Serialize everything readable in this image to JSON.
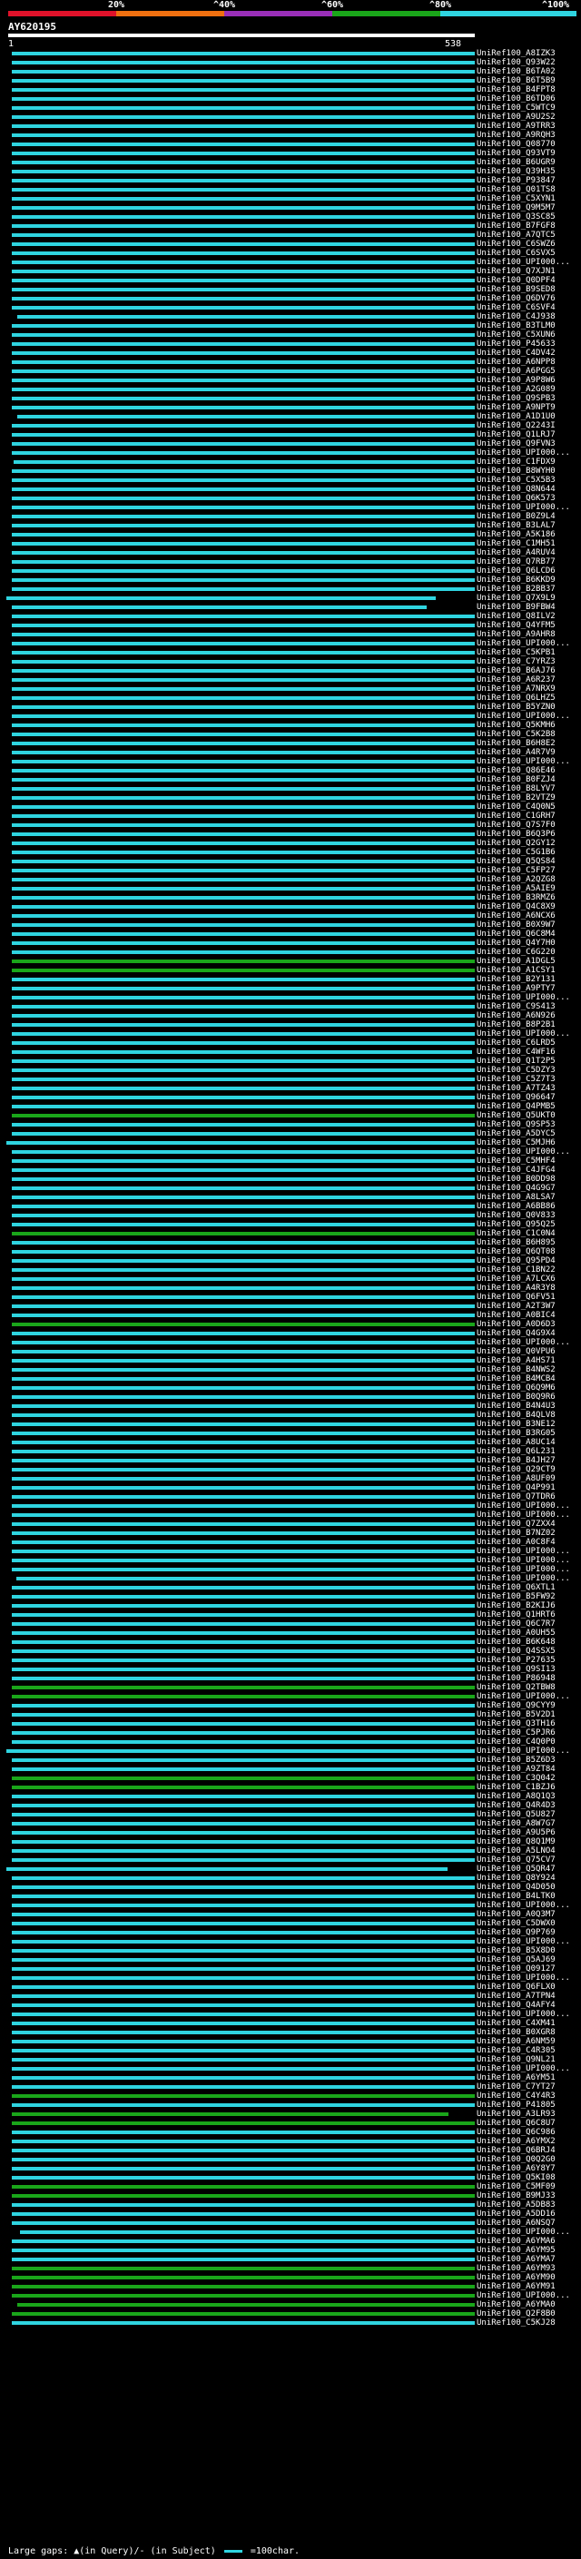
{
  "legend": {
    "labels": [
      "20%",
      "^40%",
      "^60%",
      "^80%",
      "^100%"
    ],
    "segments": [
      {
        "color": "#e0122a"
      },
      {
        "color": "#f07010"
      },
      {
        "color": "#9a2fb8"
      },
      {
        "color": "#1aa61a"
      },
      {
        "color": "#2fd4e0"
      }
    ]
  },
  "query": {
    "id": "AY620195",
    "start": "1",
    "end": "538"
  },
  "colors": {
    "cyan": "#2fd4e0",
    "green": "#1aa61a",
    "white": "#ffffff"
  },
  "hits": [
    {
      "acc": "UniRef100_A8IZK3"
    },
    {
      "acc": "UniRef100_Q93W22"
    },
    {
      "acc": "UniRef100_B6TA02"
    },
    {
      "acc": "UniRef100_B6T5B9"
    },
    {
      "acc": "UniRef100_B4FPT8"
    },
    {
      "acc": "UniRef100_B6TD06"
    },
    {
      "acc": "UniRef100_C5WTC9"
    },
    {
      "acc": "UniRef100_A9U2S2"
    },
    {
      "acc": "UniRef100_A9TRR3"
    },
    {
      "acc": "UniRef100_A9RQH3"
    },
    {
      "acc": "UniRef100_Q08770"
    },
    {
      "acc": "UniRef100_Q93VT9"
    },
    {
      "acc": "UniRef100_B6UGR9"
    },
    {
      "acc": "UniRef100_Q39H35"
    },
    {
      "acc": "UniRef100_P93847"
    },
    {
      "acc": "UniRef100_Q01TS8"
    },
    {
      "acc": "UniRef100_C5XYN1"
    },
    {
      "acc": "UniRef100_Q9M5M7"
    },
    {
      "acc": "UniRef100_Q3SC85"
    },
    {
      "acc": "UniRef100_B7FGF8"
    },
    {
      "acc": "UniRef100_A7QTC5"
    },
    {
      "acc": "UniRef100_C6SWZ6"
    },
    {
      "acc": "UniRef100_C6SVX5"
    },
    {
      "acc": "UniRef100_UPI000..."
    },
    {
      "acc": "UniRef100_Q7XJN1"
    },
    {
      "acc": "UniRef100_Q0DPF4"
    },
    {
      "acc": "UniRef100_B9SED8"
    },
    {
      "acc": "UniRef100_Q6DV76"
    },
    {
      "acc": "UniRef100_C6SVF4"
    },
    {
      "acc": "UniRef100_C4J938"
    },
    {
      "acc": "UniRef100_B3TLM0"
    },
    {
      "acc": "UniRef100_C5XUN6"
    },
    {
      "acc": "UniRef100_P45633"
    },
    {
      "acc": "UniRef100_C4DV42"
    },
    {
      "acc": "UniRef100_A6NPP8"
    },
    {
      "acc": "UniRef100_A6PGG5"
    },
    {
      "acc": "UniRef100_A9P8W6"
    },
    {
      "acc": "UniRef100_A2G089"
    },
    {
      "acc": "UniRef100_Q9SPB3"
    },
    {
      "acc": "UniRef100_A9NPT9"
    },
    {
      "acc": "UniRef100_A1D1U0"
    },
    {
      "acc": "UniRef100_Q2243I"
    },
    {
      "acc": "UniRef100_Q1LRJ7"
    },
    {
      "acc": "UniRef100_Q9FVN3"
    },
    {
      "acc": "UniRef100_UPI000..."
    },
    {
      "acc": "UniRef100_C1FDX9"
    },
    {
      "acc": "UniRef100_B8WYH0"
    },
    {
      "acc": "UniRef100_C5X5B3"
    },
    {
      "acc": "UniRef100_Q8N644"
    },
    {
      "acc": "UniRef100_Q6K573"
    },
    {
      "acc": "UniRef100_UPI000..."
    },
    {
      "acc": "UniRef100_B0Z9L4"
    },
    {
      "acc": "UniRef100_B3LAL7"
    },
    {
      "acc": "UniRef100_A5K186"
    },
    {
      "acc": "UniRef100_C1MH51"
    },
    {
      "acc": "UniRef100_A4RUV4"
    },
    {
      "acc": "UniRef100_Q7RB77"
    },
    {
      "acc": "UniRef100_Q6LCD6"
    },
    {
      "acc": "UniRef100_B6KKD9"
    },
    {
      "acc": "UniRef100_B2BB37"
    },
    {
      "acc": "UniRef100_Q7X9L9"
    },
    {
      "acc": "UniRef100_B9FBW4"
    },
    {
      "acc": "UniRef100_Q8ILV2"
    },
    {
      "acc": "UniRef100_Q4YFM5"
    },
    {
      "acc": "UniRef100_A9AHR8"
    },
    {
      "acc": "UniRef100_UPI000..."
    },
    {
      "acc": "UniRef100_C5KPB1"
    },
    {
      "acc": "UniRef100_C7YRZ3"
    },
    {
      "acc": "UniRef100_B6AJ76"
    },
    {
      "acc": "UniRef100_A6R237"
    },
    {
      "acc": "UniRef100_A7NRX9"
    },
    {
      "acc": "UniRef100_Q6LHZ5"
    },
    {
      "acc": "UniRef100_B5YZN0"
    },
    {
      "acc": "UniRef100_UPI000..."
    },
    {
      "acc": "UniRef100_Q5KMH6"
    },
    {
      "acc": "UniRef100_C5K2B8"
    },
    {
      "acc": "UniRef100_B6H8E2"
    },
    {
      "acc": "UniRef100_A4R7V9"
    },
    {
      "acc": "UniRef100_UPI000..."
    },
    {
      "acc": "UniRef100_Q86E46"
    },
    {
      "acc": "UniRef100_B0FZJ4"
    },
    {
      "acc": "UniRef100_B8LYV7"
    },
    {
      "acc": "UniRef100_B2VTZ9"
    },
    {
      "acc": "UniRef100_C4Q0N5"
    },
    {
      "acc": "UniRef100_C1GRH7"
    },
    {
      "acc": "UniRef100_Q7S7F0"
    },
    {
      "acc": "UniRef100_B6Q3P6"
    },
    {
      "acc": "UniRef100_Q2GY12"
    },
    {
      "acc": "UniRef100_C5G1B6"
    },
    {
      "acc": "UniRef100_Q5QS84"
    },
    {
      "acc": "UniRef100_C5FP27"
    },
    {
      "acc": "UniRef100_A2QZG8"
    },
    {
      "acc": "UniRef100_A5AIE9"
    },
    {
      "acc": "UniRef100_B3RMZ6"
    },
    {
      "acc": "UniRef100_Q4C8X9"
    },
    {
      "acc": "UniRef100_A6NCX6"
    },
    {
      "acc": "UniRef100_B0X9W7"
    },
    {
      "acc": "UniRef100_Q6C8M4"
    },
    {
      "acc": "UniRef100_Q4Y7H0"
    },
    {
      "acc": "UniRef100_C6G220"
    },
    {
      "acc": "UniRef100_A1DGL5"
    },
    {
      "acc": "UniRef100_A1CSY1"
    },
    {
      "acc": "UniRef100_B2Y131"
    },
    {
      "acc": "UniRef100_A9PTY7"
    },
    {
      "acc": "UniRef100_UPI000..."
    },
    {
      "acc": "UniRef100_C9S413"
    },
    {
      "acc": "UniRef100_A6N926"
    },
    {
      "acc": "UniRef100_B8P2B1"
    },
    {
      "acc": "UniRef100_UPI000..."
    },
    {
      "acc": "UniRef100_C6LRD5"
    },
    {
      "acc": "UniRef100_C4WF16"
    },
    {
      "acc": "UniRef100_Q1T2P5"
    },
    {
      "acc": "UniRef100_C5DZY3"
    },
    {
      "acc": "UniRef100_C5Z7T3"
    },
    {
      "acc": "UniRef100_A7TZ43"
    },
    {
      "acc": "UniRef100_Q96647"
    },
    {
      "acc": "UniRef100_Q4PMB5"
    },
    {
      "acc": "UniRef100_Q5UKT0"
    },
    {
      "acc": "UniRef100_Q9SP53"
    },
    {
      "acc": "UniRef100_A5DYC5"
    },
    {
      "acc": "UniRef100_C5MJH6"
    },
    {
      "acc": "UniRef100_UPI000..."
    },
    {
      "acc": "UniRef100_C5MHF4"
    },
    {
      "acc": "UniRef100_C4JFG4"
    },
    {
      "acc": "UniRef100_B0DD98"
    },
    {
      "acc": "UniRef100_Q4G9G7"
    },
    {
      "acc": "UniRef100_A8LSA7"
    },
    {
      "acc": "UniRef100_A6BB86"
    },
    {
      "acc": "UniRef100_Q0V833"
    },
    {
      "acc": "UniRef100_Q95Q25"
    },
    {
      "acc": "UniRef100_C1C0N4"
    },
    {
      "acc": "UniRef100_B6H895"
    },
    {
      "acc": "UniRef100_Q6QT08"
    },
    {
      "acc": "UniRef100_Q95PD4"
    },
    {
      "acc": "UniRef100_C1BN22"
    },
    {
      "acc": "UniRef100_A7LCX6"
    },
    {
      "acc": "UniRef100_A4R3Y8"
    },
    {
      "acc": "UniRef100_Q6FV51"
    },
    {
      "acc": "UniRef100_A2T3W7"
    },
    {
      "acc": "UniRef100_A0BIC4"
    },
    {
      "acc": "UniRef100_A0D6D3"
    },
    {
      "acc": "UniRef100_Q4G9X4"
    },
    {
      "acc": "UniRef100_UPI000..."
    },
    {
      "acc": "UniRef100_Q0VPU6"
    },
    {
      "acc": "UniRef100_A4HS71"
    },
    {
      "acc": "UniRef100_B4NWS2"
    },
    {
      "acc": "UniRef100_B4MCB4"
    },
    {
      "acc": "UniRef100_Q6Q9M6"
    },
    {
      "acc": "UniRef100_B0Q9R6"
    },
    {
      "acc": "UniRef100_B4N4U3"
    },
    {
      "acc": "UniRef100_B4QLV8"
    },
    {
      "acc": "UniRef100_B3NE12"
    },
    {
      "acc": "UniRef100_B3RG05"
    },
    {
      "acc": "UniRef100_A8UC14"
    },
    {
      "acc": "UniRef100_Q6L231"
    },
    {
      "acc": "UniRef100_B4JH27"
    },
    {
      "acc": "UniRef100_Q29CT9"
    },
    {
      "acc": "UniRef100_A8UF09"
    },
    {
      "acc": "UniRef100_Q4P991"
    },
    {
      "acc": "UniRef100_Q7TDR6"
    },
    {
      "acc": "UniRef100_UPI000..."
    },
    {
      "acc": "UniRef100_UPI000..."
    },
    {
      "acc": "UniRef100_Q7ZXX4"
    },
    {
      "acc": "UniRef100_B7NZ02"
    },
    {
      "acc": "UniRef100_A0C8F4"
    },
    {
      "acc": "UniRef100_UPI000..."
    },
    {
      "acc": "UniRef100_UPI000..."
    },
    {
      "acc": "UniRef100_UPI000..."
    },
    {
      "acc": "UniRef100_UPI000..."
    },
    {
      "acc": "UniRef100_Q6XTL1"
    },
    {
      "acc": "UniRef100_B5FW92"
    },
    {
      "acc": "UniRef100_B2KIJ6"
    },
    {
      "acc": "UniRef100_Q1HRT6"
    },
    {
      "acc": "UniRef100_Q6C7R7"
    },
    {
      "acc": "UniRef100_A0UH55"
    },
    {
      "acc": "UniRef100_B6K648"
    },
    {
      "acc": "UniRef100_Q4SSX5"
    },
    {
      "acc": "UniRef100_P27635"
    },
    {
      "acc": "UniRef100_Q9SI13"
    },
    {
      "acc": "UniRef100_P86948"
    },
    {
      "acc": "UniRef100_Q2TBW8"
    },
    {
      "acc": "UniRef100_UPI000..."
    },
    {
      "acc": "UniRef100_Q9CYY9"
    },
    {
      "acc": "UniRef100_B5V2D1"
    },
    {
      "acc": "UniRef100_Q3TH16"
    },
    {
      "acc": "UniRef100_C5PJR6"
    },
    {
      "acc": "UniRef100_C4Q0P0"
    },
    {
      "acc": "UniRef100_UPI000..."
    },
    {
      "acc": "UniRef100_B5Z6D3"
    },
    {
      "acc": "UniRef100_A9ZT84"
    },
    {
      "acc": "UniRef100_C3Q042"
    },
    {
      "acc": "UniRef100_C1BZJ6"
    },
    {
      "acc": "UniRef100_A8Q1Q3"
    },
    {
      "acc": "UniRef100_Q4R4D3"
    },
    {
      "acc": "UniRef100_Q5U827"
    },
    {
      "acc": "UniRef100_A8W7G7"
    },
    {
      "acc": "UniRef100_A9U5P6"
    },
    {
      "acc": "UniRef100_Q8Q1M9"
    },
    {
      "acc": "UniRef100_A5LNO4"
    },
    {
      "acc": "UniRef100_Q75CV7"
    },
    {
      "acc": "UniRef100_Q5QR47"
    },
    {
      "acc": "UniRef100_Q8Y924"
    },
    {
      "acc": "UniRef100_Q4D050"
    },
    {
      "acc": "UniRef100_B4LTK0"
    },
    {
      "acc": "UniRef100_UPI000..."
    },
    {
      "acc": "UniRef100_A0Q3M7"
    },
    {
      "acc": "UniRef100_C5DWX0"
    },
    {
      "acc": "UniRef100_Q9P769"
    },
    {
      "acc": "UniRef100_UPI000..."
    },
    {
      "acc": "UniRef100_B5X8D0"
    },
    {
      "acc": "UniRef100_Q5AJ69"
    },
    {
      "acc": "UniRef100_Q09127"
    },
    {
      "acc": "UniRef100_UPI000..."
    },
    {
      "acc": "UniRef100_Q6FLX0"
    },
    {
      "acc": "UniRef100_A7TPN4"
    },
    {
      "acc": "UniRef100_Q4AFY4"
    },
    {
      "acc": "UniRef100_UPI000..."
    },
    {
      "acc": "UniRef100_C4XM41"
    },
    {
      "acc": "UniRef100_B0XGR8"
    },
    {
      "acc": "UniRef100_A6NM59"
    },
    {
      "acc": "UniRef100_C4R305"
    },
    {
      "acc": "UniRef100_Q9NL21"
    },
    {
      "acc": "UniRef100_UPI000..."
    },
    {
      "acc": "UniRef100_A6YM51"
    },
    {
      "acc": "UniRef100_C7YT27"
    },
    {
      "acc": "UniRef100_C4Y4R3"
    },
    {
      "acc": "UniRef100_P41805"
    },
    {
      "acc": "UniRef100_A3LR93"
    },
    {
      "acc": "UniRef100_Q6C8U7"
    },
    {
      "acc": "UniRef100_Q6C986"
    },
    {
      "acc": "UniRef100_A6YMX2"
    },
    {
      "acc": "UniRef100_Q6BRJ4"
    },
    {
      "acc": "UniRef100_Q0Q2G0"
    },
    {
      "acc": "UniRef100_A6Y8Y7"
    },
    {
      "acc": "UniRef100_Q5KI08"
    },
    {
      "acc": "UniRef100_C5MF09"
    },
    {
      "acc": "UniRef100_B9MJ33"
    },
    {
      "acc": "UniRef100_A5DB83"
    },
    {
      "acc": "UniRef100_A5DD16"
    },
    {
      "acc": "UniRef100_A6NSQ7"
    },
    {
      "acc": "UniRef100_UPI000..."
    },
    {
      "acc": "UniRef100_A6YMA6"
    },
    {
      "acc": "UniRef100_A6YM95"
    },
    {
      "acc": "UniRef100_A6YMA7"
    },
    {
      "acc": "UniRef100_A6YM93"
    },
    {
      "acc": "UniRef100_A6YM90"
    },
    {
      "acc": "UniRef100_A6YM91"
    },
    {
      "acc": "UniRef100_UPI000..."
    },
    {
      "acc": "UniRef100_A6YMA0"
    },
    {
      "acc": "UniRef100_Q2F8B0"
    },
    {
      "acc": "UniRef100_C5KJ28"
    }
  ],
  "footer": {
    "text": "Large gaps: ▲(in Query)/- (in Subject)",
    "scale": "=100char."
  }
}
